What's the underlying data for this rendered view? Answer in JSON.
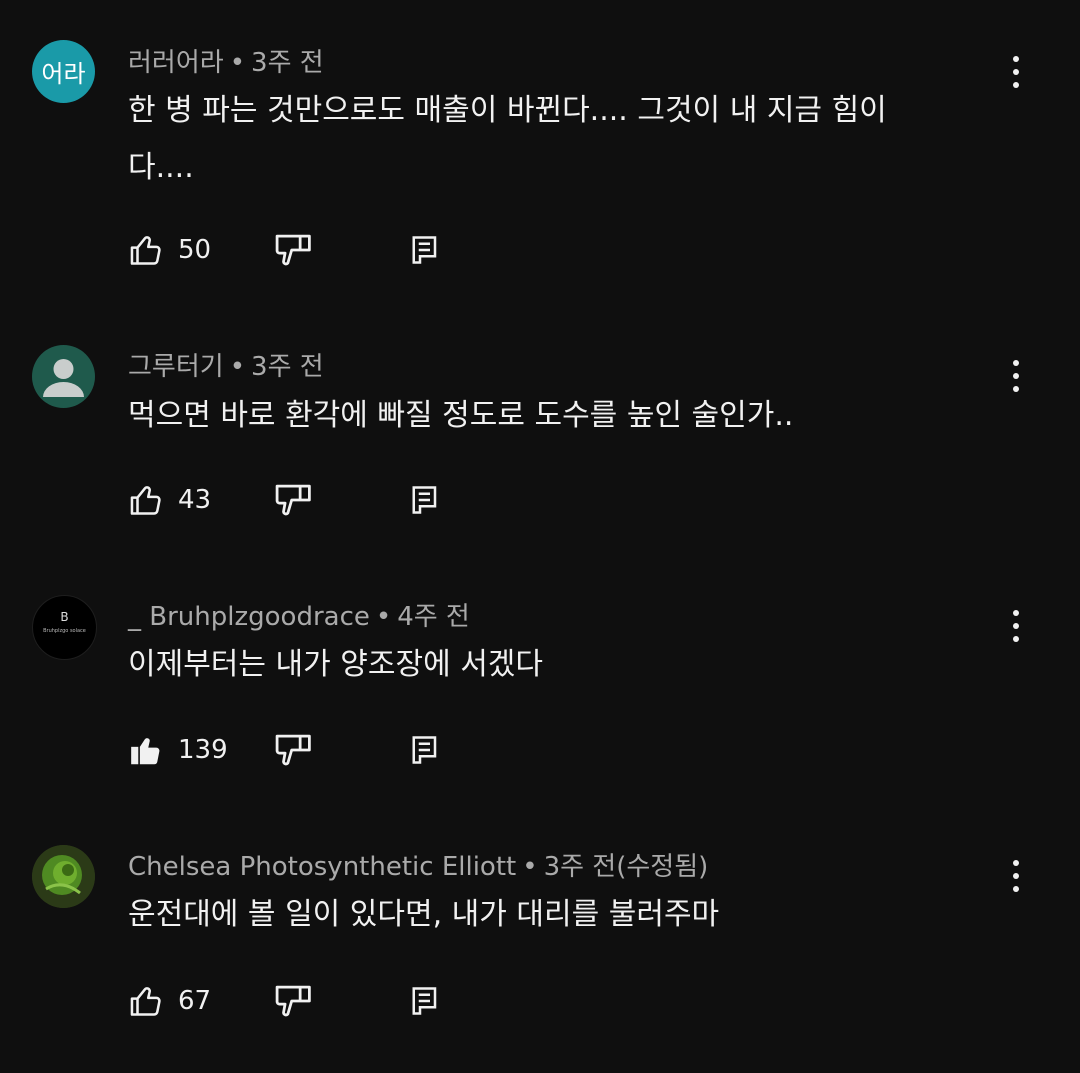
{
  "comments": [
    {
      "author": "러러어라",
      "separator": "•",
      "time": "3주 전",
      "text": "한 병 파는 것만으로도 매출이 바뀐다.... 그것이 내 지금 힘이다....",
      "likes": "50",
      "liked": false,
      "avatar_text": "어라",
      "avatar_color": "#1a9aa8"
    },
    {
      "author": "그루터기",
      "separator": "•",
      "time": "3주 전",
      "text": "먹으면 바로 환각에 빠질 정도로 도수를 높인 술인가..",
      "likes": "43",
      "liked": false,
      "avatar_color": "#1f5a4c"
    },
    {
      "author": "_ Bruhplzgoodrace",
      "separator": "•",
      "time": "4주 전",
      "text": "이제부터는 내가 양조장에 서겠다",
      "likes": "139",
      "liked": true,
      "avatar_letter": "B",
      "avatar_caption": "Bruhplzgo solace",
      "avatar_color": "#000000"
    },
    {
      "author": "Chelsea Photosynthetic Elliott",
      "separator": "•",
      "time": "3주 전(수정됨)",
      "text": "운전대에 볼 일이 있다면, 내가 대리를 불러주마",
      "likes": "67",
      "liked": false,
      "avatar_color": "#3d6b1f"
    }
  ],
  "icons": {
    "like": "thumb-up-icon",
    "dislike": "thumb-down-icon",
    "reply": "reply-comment-icon",
    "more": "more-vert-icon"
  }
}
